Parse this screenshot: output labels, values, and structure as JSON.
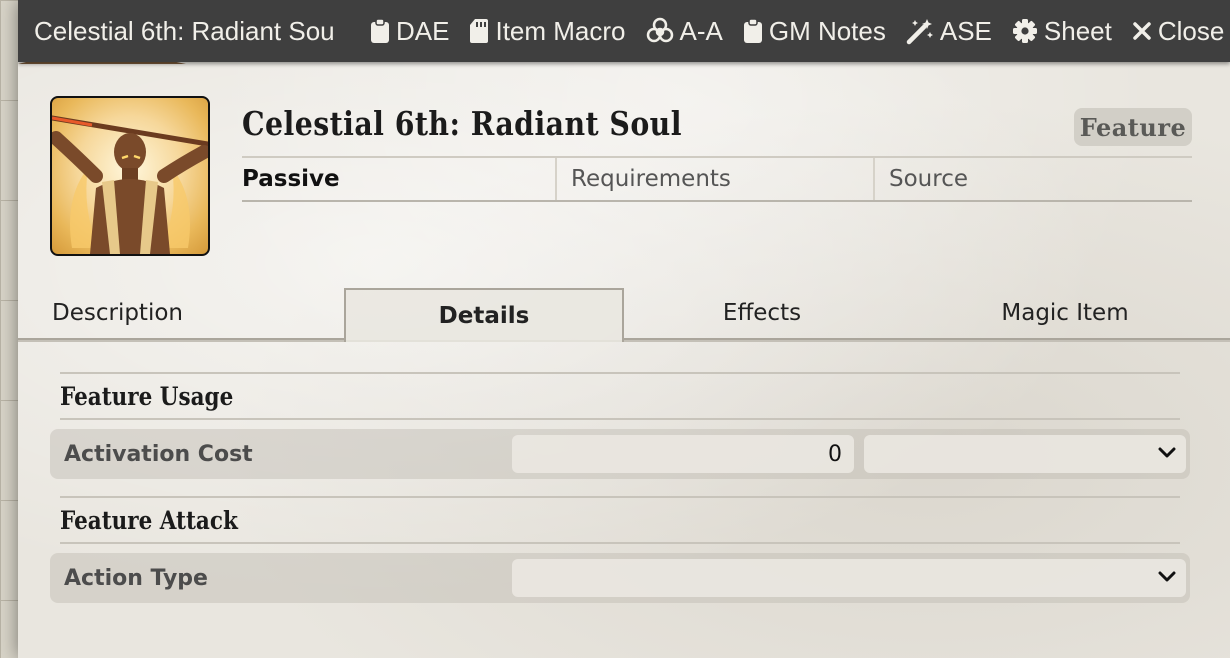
{
  "header": {
    "window_title": "Celestial 6th: Radiant Sou",
    "buttons": [
      {
        "label": "DAE",
        "icon": "clipboard-icon"
      },
      {
        "label": "Item Macro",
        "icon": "sd-card-icon"
      },
      {
        "label": "A-A",
        "icon": "biohazard-icon"
      },
      {
        "label": "GM Notes",
        "icon": "clipboard-icon"
      },
      {
        "label": "ASE",
        "icon": "magic-wand-icon"
      },
      {
        "label": "Sheet",
        "icon": "gear-icon"
      },
      {
        "label": "Close",
        "icon": "close-icon"
      }
    ]
  },
  "item": {
    "name": "Celestial 6th: Radiant Soul",
    "type": "Feature",
    "summary": {
      "activation": "Passive",
      "requirements_placeholder": "Requirements",
      "source_placeholder": "Source"
    }
  },
  "tabs": [
    {
      "label": "Description",
      "active": false
    },
    {
      "label": "Details",
      "active": true
    },
    {
      "label": "Effects",
      "active": false
    },
    {
      "label": "Magic Item",
      "active": false
    }
  ],
  "details": {
    "usage": {
      "heading": "Feature Usage",
      "activation_label": "Activation Cost",
      "activation_value": "0",
      "activation_type": ""
    },
    "attack": {
      "heading": "Feature Attack",
      "action_type_label": "Action Type",
      "action_type_value": ""
    }
  },
  "colors": {
    "titlebar": "#3f3f3f",
    "sheet_background": "#e9e6df",
    "type_badge": "#d2cfc7"
  }
}
